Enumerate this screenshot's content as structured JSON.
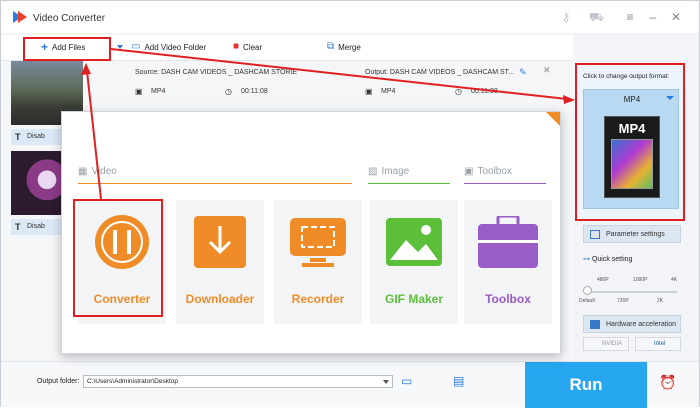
{
  "window": {
    "title": "Video Converter"
  },
  "toolbar": {
    "add_files": "Add Files",
    "add_video_folder": "Add Video Folder",
    "clear": "Clear",
    "merge": "Merge"
  },
  "file_item": {
    "source": "Source: DASH CAM VIDEOS _ DASHCAM STORIE",
    "output": "Output: DASH CAM VIDEOS _ DASHCAM ST...",
    "src_format": "MP4",
    "src_duration": "00:11:08",
    "out_format": "MP4",
    "out_duration": "00:11:08",
    "disable_label_1": "Disab",
    "disable_label_2": "Disab"
  },
  "output_panel": {
    "hint": "Click to change output format:",
    "format": "MP4",
    "format_image_text": "MP4",
    "parameter_settings": "Parameter settings",
    "quick_setting": "Quick setting",
    "ticks_top": [
      "480P",
      "1080P",
      "4K"
    ],
    "ticks_bottom": [
      "Default",
      "720P",
      "2K"
    ],
    "hardware_acceleration": "Hardware acceleration",
    "chip_nvidia": "NVIDIA",
    "chip_intel": "Intel"
  },
  "bottom": {
    "output_folder_label": "Output folder:",
    "output_path": "C:\\Users\\Administrator\\Desktop",
    "run": "Run"
  },
  "popup": {
    "sections": {
      "video": "Video",
      "image": "Image",
      "toolbox": "Toolbox"
    },
    "tiles": [
      {
        "label": "Converter",
        "color": "#f08c28"
      },
      {
        "label": "Downloader",
        "color": "#f08c28"
      },
      {
        "label": "Recorder",
        "color": "#f08c28"
      },
      {
        "label": "GIF Maker",
        "color": "#5bbf3a"
      },
      {
        "label": "Toolbox",
        "color": "#9a5cc6"
      }
    ]
  },
  "colors": {
    "accent": "#27a7f0",
    "annotation": "#e02020",
    "orange": "#f08c28",
    "green": "#5bbf3a",
    "purple": "#9a5cc6"
  }
}
